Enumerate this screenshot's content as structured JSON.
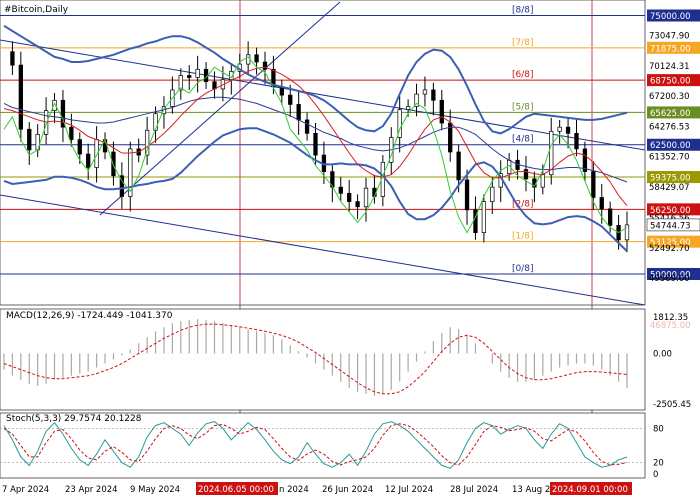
{
  "chart_data": {
    "type": "line",
    "instrument_label": "#Bitcoin,Daily",
    "main_panel": {
      "ylim": [
        47000,
        76500
      ],
      "y_tick_labels": [
        "73047.90",
        "70124.31",
        "67200.30",
        "64276.53",
        "61352.70",
        "58429.07",
        "55416.56",
        "52492.70",
        "49589.00"
      ],
      "price_levels": [
        {
          "label": "75000.00",
          "value": 75000,
          "color": "#1f2f8f",
          "murray": "[8/8]"
        },
        {
          "label": "71875.00",
          "value": 71875,
          "color": "#f5a623",
          "murray": "[7/8]"
        },
        {
          "label": "68750.00",
          "value": 68750,
          "color": "#cc1111",
          "murray": "[6/8]"
        },
        {
          "label": "65625.00",
          "value": 65625,
          "color": "#6b8e23",
          "murray": "[5/8]"
        },
        {
          "label": "62500.00",
          "value": 62500,
          "color": "#1f2f8f",
          "murray": "[4/8]"
        },
        {
          "label": "59375.00",
          "value": 59375,
          "color": "#9a9a00",
          "murray": ""
        },
        {
          "label": "56250.00",
          "value": 56250,
          "color": "#cc1111",
          "murray": "[2/8]"
        },
        {
          "label": "53125.00",
          "value": 53125,
          "color": "#f5a623",
          "murray": "[1/8]"
        },
        {
          "label": "50000.00",
          "value": 50000,
          "color": "#1f2f8f",
          "murray": "[0/8]"
        }
      ],
      "current_price_label": "54744.73",
      "current_price": 54744.73,
      "hidden_level_label": "46875.00",
      "series": [
        {
          "name": "Close",
          "values": [
            71500,
            70200,
            64000,
            62000,
            63500,
            65800,
            66800,
            64200,
            63000,
            61600,
            60300,
            63000,
            61800,
            59500,
            57500,
            62100,
            61500,
            63900,
            65500,
            66200,
            67800,
            69200,
            69000,
            69800,
            68600,
            67900,
            68800,
            69600,
            70300,
            71200,
            70500,
            69800,
            68100,
            67300,
            66400,
            64900,
            63600,
            61500,
            59900,
            58400,
            57800,
            57000,
            56500,
            58300,
            57500,
            60800,
            63200,
            65900,
            66200,
            67400,
            67800,
            66800,
            64600,
            61800,
            59100,
            56200,
            54000,
            57000,
            58400,
            59700,
            61000,
            60100,
            59200,
            58400,
            59600,
            63800,
            64200,
            63600,
            62100,
            59900,
            57400,
            56300,
            54700,
            53300,
            54744.73
          ]
        },
        {
          "name": "Bollinger Upper",
          "values": [
            74000,
            73500,
            73000,
            72500,
            72000,
            71500,
            71000,
            70800,
            70500,
            70500,
            70600,
            70800,
            71000,
            71200,
            71500,
            71800,
            72000,
            72300,
            72500,
            72800,
            73000,
            73000,
            72800,
            72400,
            71900,
            71400,
            70800,
            70300,
            69800,
            69300,
            68900,
            68600,
            68300,
            68100,
            67900,
            67700,
            67500,
            67200,
            66800,
            66200,
            65500,
            64800,
            64200,
            63900,
            63800,
            64300,
            65500,
            67400,
            69200,
            70500,
            71300,
            71700,
            71600,
            71000,
            69800,
            68200,
            66400,
            64800,
            63800,
            63600,
            64000,
            64600,
            65200,
            65500,
            65400,
            65300,
            65200,
            65100,
            65000,
            64900,
            64900,
            65000,
            65200,
            65400,
            65600
          ]
        },
        {
          "name": "Bollinger Middle",
          "values": [
            66500,
            66100,
            65900,
            65700,
            65500,
            65300,
            65200,
            65100,
            64900,
            64800,
            64700,
            64600,
            64600,
            64700,
            64900,
            65100,
            65300,
            65500,
            65700,
            65900,
            66100,
            66400,
            66700,
            66900,
            67000,
            67100,
            67100,
            67000,
            66900,
            66700,
            66500,
            66200,
            65900,
            65600,
            65300,
            64900,
            64500,
            64100,
            63700,
            63400,
            63100,
            62700,
            62400,
            62200,
            62000,
            61900,
            62000,
            62200,
            62500,
            62900,
            63300,
            63700,
            64000,
            64200,
            64200,
            63900,
            63500,
            62800,
            62100,
            61500,
            61000,
            60600,
            60400,
            60200,
            60100,
            60100,
            60200,
            60300,
            60300,
            60200,
            60000,
            59800,
            59500,
            59200,
            58900
          ]
        },
        {
          "name": "Bollinger Lower",
          "values": [
            59000,
            58700,
            58800,
            58900,
            59000,
            59100,
            59400,
            59400,
            59300,
            59100,
            58800,
            58400,
            58200,
            58200,
            58300,
            58400,
            58600,
            58700,
            58900,
            59000,
            59200,
            59800,
            60600,
            61400,
            62100,
            62800,
            63400,
            63700,
            64000,
            64100,
            64100,
            63800,
            63500,
            63100,
            62700,
            62100,
            61500,
            61000,
            60600,
            60600,
            60700,
            60600,
            60600,
            60500,
            60200,
            59500,
            58500,
            57000,
            55800,
            55300,
            55300,
            55700,
            56400,
            57400,
            58600,
            59600,
            60600,
            60800,
            60400,
            59400,
            58000,
            56600,
            55600,
            54900,
            54800,
            54900,
            55200,
            55500,
            55600,
            55500,
            55100,
            54600,
            53800,
            53000,
            52200
          ]
        },
        {
          "name": "Signal Line",
          "values": [
            66000,
            65800,
            65500,
            65200,
            64900,
            64700,
            64800,
            64700,
            64400,
            63900,
            63300,
            63000,
            62700,
            62200,
            61700,
            61700,
            61800,
            62300,
            62900,
            63600,
            64400,
            65300,
            66100,
            66900,
            67500,
            67900,
            68300,
            68700,
            69100,
            69600,
            69900,
            70000,
            69700,
            69300,
            68800,
            68200,
            67400,
            66400,
            65300,
            64100,
            62900,
            61700,
            60600,
            60000,
            59500,
            59400,
            59600,
            60400,
            61500,
            62800,
            64000,
            64900,
            65200,
            64700,
            63800,
            62300,
            60800,
            59800,
            59300,
            59300,
            59600,
            59900,
            59900,
            59700,
            59600,
            60100,
            60800,
            61400,
            61700,
            61500,
            60800,
            59900,
            58900,
            57600,
            56600
          ]
        },
        {
          "name": "Lead Line",
          "values": [
            64000,
            65200,
            63000,
            61500,
            62000,
            64500,
            66500,
            65000,
            62500,
            61000,
            60000,
            61500,
            63000,
            60500,
            59000,
            58000,
            59500,
            62000,
            64000,
            66000,
            67000,
            68000,
            67500,
            68500,
            69000,
            70000,
            69500,
            69000,
            70500,
            71000,
            70000,
            69500,
            68000,
            66500,
            64000,
            63000,
            62000,
            60500,
            59500,
            58500,
            57000,
            56000,
            55000,
            56000,
            57500,
            59500,
            61500,
            64000,
            65500,
            66500,
            66000,
            64000,
            61500,
            58000,
            55500,
            54000,
            55500,
            57500,
            59000,
            60000,
            60500,
            59500,
            59000,
            58500,
            60000,
            62500,
            63500,
            62500,
            61000,
            59000,
            57000,
            55500,
            54500,
            54000,
            54500
          ]
        }
      ]
    },
    "macd_panel": {
      "label": "MACD(12,26,9) -1724.449 -1041.370",
      "y_tick_labels": [
        "1812.35",
        "0.00",
        "-2505.45"
      ],
      "ylim": [
        -2800,
        2200
      ],
      "series": [
        {
          "name": "Histogram",
          "values": [
            -800,
            -1100,
            -1300,
            -1500,
            -1600,
            -1500,
            -1300,
            -1200,
            -1100,
            -1000,
            -900,
            -700,
            -500,
            -300,
            -100,
            200,
            500,
            800,
            1100,
            1300,
            1500,
            1600,
            1650,
            1700,
            1650,
            1600,
            1500,
            1400,
            1300,
            1200,
            1100,
            1000,
            900,
            700,
            400,
            100,
            -200,
            -500,
            -800,
            -1100,
            -1400,
            -1700,
            -1900,
            -2000,
            -2100,
            -2000,
            -1800,
            -1400,
            -900,
            -400,
            100,
            600,
            1000,
            1300,
            1200,
            900,
            500,
            0,
            -500,
            -900,
            -1200,
            -1400,
            -1400,
            -1300,
            -1100,
            -900,
            -700,
            -600,
            -500,
            -500,
            -600,
            -800,
            -1100,
            -1400,
            -1724
          ]
        },
        {
          "name": "Signal",
          "values": [
            -500,
            -650,
            -800,
            -950,
            -1100,
            -1200,
            -1250,
            -1250,
            -1200,
            -1150,
            -1100,
            -1000,
            -850,
            -700,
            -500,
            -250,
            0,
            250,
            500,
            750,
            950,
            1150,
            1300,
            1400,
            1450,
            1450,
            1420,
            1380,
            1320,
            1250,
            1180,
            1100,
            1000,
            900,
            750,
            550,
            300,
            50,
            -250,
            -550,
            -850,
            -1150,
            -1450,
            -1700,
            -1900,
            -2000,
            -2000,
            -1900,
            -1650,
            -1300,
            -900,
            -400,
            100,
            500,
            800,
            900,
            800,
            500,
            100,
            -300,
            -700,
            -1000,
            -1200,
            -1300,
            -1300,
            -1250,
            -1150,
            -1050,
            -950,
            -900,
            -900,
            -920,
            -960,
            -1000,
            -1041
          ]
        }
      ]
    },
    "stoch_panel": {
      "label": "Stoch(5,3,3) 29.7574 20.1228",
      "y_tick_labels": [
        "80",
        "20",
        "0"
      ],
      "ylim": [
        0,
        100
      ],
      "series": [
        {
          "name": "%K",
          "values": [
            85,
            60,
            30,
            15,
            40,
            75,
            90,
            70,
            45,
            25,
            15,
            35,
            60,
            40,
            20,
            12,
            30,
            65,
            85,
            90,
            80,
            70,
            50,
            72,
            88,
            92,
            80,
            60,
            75,
            90,
            78,
            60,
            40,
            25,
            18,
            30,
            55,
            35,
            18,
            12,
            20,
            35,
            15,
            40,
            70,
            88,
            92,
            85,
            75,
            60,
            45,
            30,
            15,
            10,
            25,
            55,
            80,
            90,
            85,
            70,
            78,
            85,
            80,
            60,
            45,
            70,
            88,
            80,
            55,
            30,
            20,
            12,
            15,
            25,
            29.76
          ]
        },
        {
          "name": "%D",
          "values": [
            80,
            70,
            50,
            30,
            30,
            55,
            75,
            78,
            62,
            42,
            28,
            25,
            40,
            48,
            38,
            25,
            22,
            40,
            62,
            80,
            85,
            80,
            68,
            62,
            72,
            85,
            87,
            80,
            70,
            75,
            82,
            78,
            62,
            45,
            30,
            24,
            35,
            42,
            35,
            22,
            16,
            22,
            25,
            30,
            45,
            68,
            85,
            88,
            85,
            75,
            62,
            48,
            32,
            20,
            16,
            30,
            52,
            75,
            85,
            82,
            76,
            78,
            81,
            75,
            62,
            58,
            68,
            78,
            74,
            58,
            38,
            22,
            16,
            17,
            20.12
          ]
        }
      ]
    },
    "x_tick_labels": [
      "7 Apr 2024",
      "23 Apr 2024",
      "9 May 2024",
      "2024.06.05 00:00",
      "n 2024",
      "26 Jun 2024",
      "12 Jul 2024",
      "28 Jul 2024",
      "13 Aug 2",
      "2024.09.01 00:00"
    ],
    "highlighted_dates": [
      "2024.06.05 00:00",
      "2024.09.01 00:00"
    ]
  }
}
